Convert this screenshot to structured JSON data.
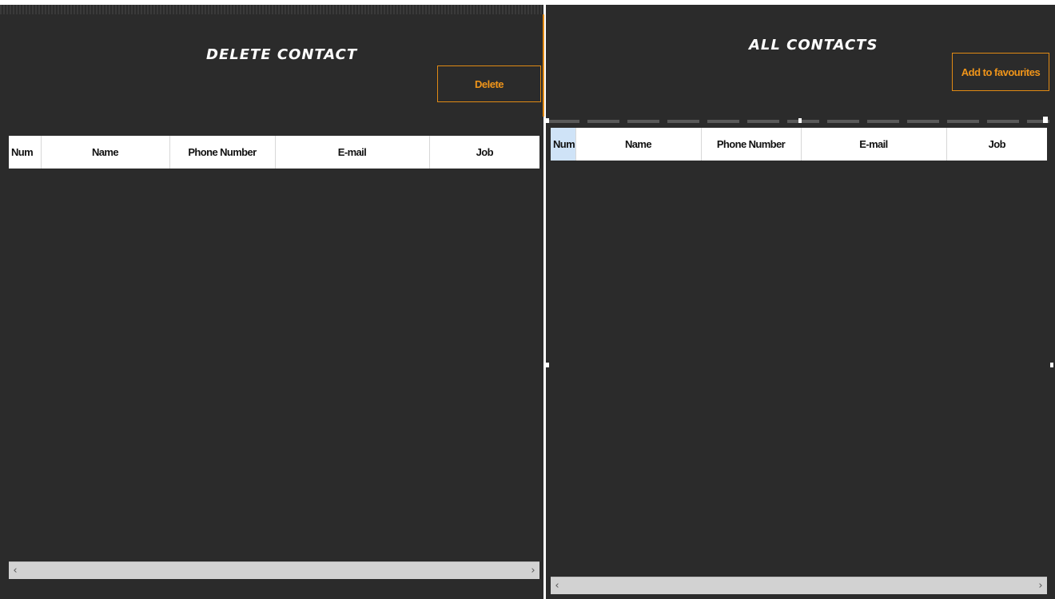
{
  "delete_panel": {
    "title": "Delete Contact",
    "button_label": "Delete",
    "columns": [
      "Num",
      "Name",
      "Phone Number",
      "E-mail",
      "Job"
    ]
  },
  "all_panel": {
    "title": "All Contacts",
    "button_label": "Add to favourites",
    "columns": [
      "Num",
      "Name",
      "Phone Number",
      "E-mail",
      "Job"
    ]
  },
  "scrollbar": {
    "left_arrow": "‹",
    "right_arrow": "›"
  },
  "colors": {
    "background": "#2b2b2b",
    "accent": "#e08a14",
    "header_bg": "#ffffff",
    "selected_header": "#cfe3f7"
  }
}
